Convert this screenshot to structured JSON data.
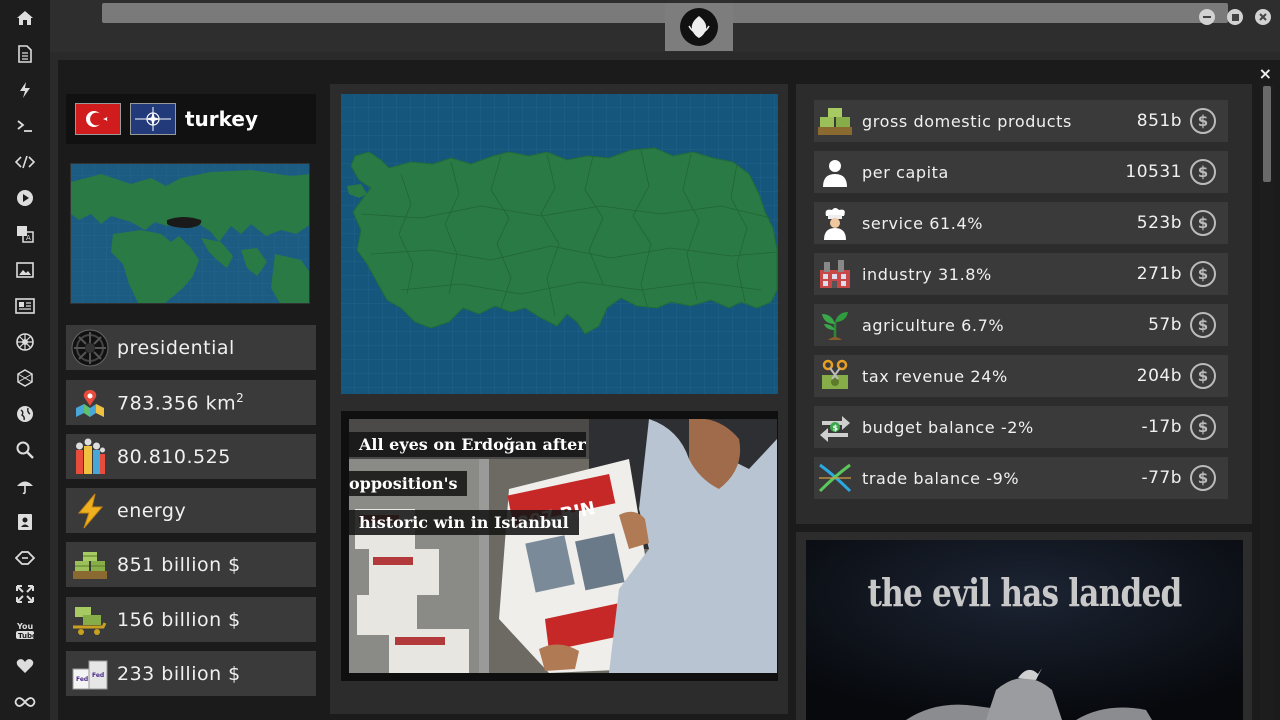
{
  "sidebar": {
    "icons": [
      "home-icon",
      "document-icon",
      "lightning-icon",
      "terminal-icon",
      "code-icon",
      "play-icon",
      "translate-icon",
      "image-icon",
      "newspaper-icon",
      "empire-icon",
      "hexagon-icon",
      "globe-icon",
      "search-icon",
      "umbrella-icon",
      "contact-card-icon",
      "tag-icon",
      "expand-icon",
      "youtube-icon",
      "heart-icon",
      "infinity-icon"
    ]
  },
  "window": {
    "emblem": "rebel-alliance-icon",
    "minimize": "minimize-icon",
    "maximize": "maximize-icon",
    "close": "close-icon"
  },
  "panel": {
    "close_label": "×"
  },
  "country": {
    "name": "turkey",
    "flags": [
      "turkey-flag",
      "nato-flag"
    ]
  },
  "facts": [
    {
      "icon": "government-icon",
      "text": "presidential"
    },
    {
      "icon": "area-map-icon",
      "text": "783.356 km",
      "sup": "2"
    },
    {
      "icon": "population-icon",
      "text": "80.810.525"
    },
    {
      "icon": "energy-icon",
      "text": "energy"
    },
    {
      "icon": "money-stack-icon",
      "text": "851 billion $"
    },
    {
      "icon": "money-cart-icon",
      "text": "156 billion $"
    },
    {
      "icon": "boxes-icon",
      "text": "233 billion $"
    }
  ],
  "economy": [
    {
      "icon": "money-stack-icon",
      "label": "gross domestic products",
      "value": "851b"
    },
    {
      "icon": "person-icon",
      "label": "per capita",
      "value": "10531"
    },
    {
      "icon": "chef-icon",
      "label": "service 61.4%",
      "value": "523b"
    },
    {
      "icon": "factory-icon",
      "label": "industry 31.8%",
      "value": "271b"
    },
    {
      "icon": "plant-icon",
      "label": "agriculture 6.7%",
      "value": "57b"
    },
    {
      "icon": "scissors-money-icon",
      "label": "tax revenue 24%",
      "value": "204b"
    },
    {
      "icon": "exchange-icon",
      "label": "budget balance -2%",
      "value": "-17b"
    },
    {
      "icon": "trade-cross-icon",
      "label": "trade balance -9%",
      "value": "-77b"
    }
  ],
  "currency_symbol": "$",
  "news": {
    "line1": "All eyes on Erdoğan after opposition's",
    "line2": "historic win in Istanbul"
  },
  "ad": {
    "text": "the evil has landed"
  },
  "colors": {
    "map_water": "#15567d",
    "map_land": "#2a7a45",
    "panel_bg": "#1b1b1b",
    "row_bg": "#3a3a3a"
  }
}
